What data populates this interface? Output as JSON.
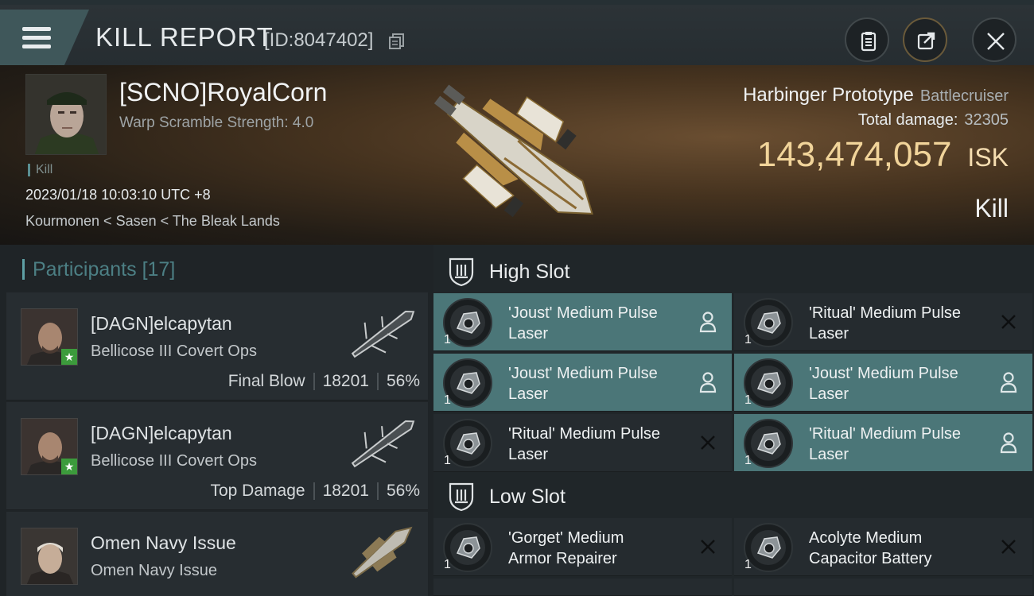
{
  "header": {
    "title": "KILL REPORT",
    "report_id": "[ID:8047402]"
  },
  "victim": {
    "name": "[SCNO]RoyalCorn",
    "warp_scramble": "Warp Scramble Strength: 4.0",
    "tag": "Kill",
    "datetime": "2023/01/18 10:03:10 UTC +8",
    "location": "Kourmonen < Sasen < The Bleak Lands",
    "ship_name": "Harbinger Prototype",
    "ship_class": "Battlecruiser",
    "total_damage_label": "Total damage:",
    "total_damage": "32305",
    "isk_value": "143,474,057",
    "isk_unit": "ISK",
    "result": "Kill"
  },
  "participants": {
    "label": "Participants",
    "count": "[17]",
    "rows": [
      {
        "name": "[DAGN]elcapytan",
        "ship": "Bellicose III Covert Ops",
        "role": "Final Blow",
        "damage": "18201",
        "percent": "56%"
      },
      {
        "name": "[DAGN]elcapytan",
        "ship": "Bellicose III Covert Ops",
        "role": "Top Damage",
        "damage": "18201",
        "percent": "56%"
      },
      {
        "name": "Omen Navy Issue",
        "ship": "Omen Navy Issue"
      }
    ]
  },
  "slots": {
    "high_label": "High Slot",
    "low_label": "Low Slot",
    "high": [
      {
        "line1": "'Joust' Medium Pulse",
        "line2": "Laser",
        "qty": "1",
        "state": "dropped"
      },
      {
        "line1": "'Ritual' Medium Pulse",
        "line2": "Laser",
        "qty": "1",
        "state": "destroyed"
      },
      {
        "line1": "'Joust' Medium Pulse",
        "line2": "Laser",
        "qty": "1",
        "state": "dropped"
      },
      {
        "line1": "'Joust' Medium Pulse",
        "line2": "Laser",
        "qty": "1",
        "state": "dropped"
      },
      {
        "line1": "'Ritual' Medium Pulse",
        "line2": "Laser",
        "qty": "1",
        "state": "destroyed"
      },
      {
        "line1": "'Ritual' Medium Pulse",
        "line2": "Laser",
        "qty": "1",
        "state": "dropped"
      }
    ],
    "low": [
      {
        "line1": "'Gorget' Medium",
        "line2": "Armor Repairer",
        "qty": "1",
        "state": "destroyed"
      },
      {
        "line1": "Acolyte Medium",
        "line2": "Capacitor Battery",
        "qty": "1",
        "state": "destroyed"
      }
    ]
  }
}
